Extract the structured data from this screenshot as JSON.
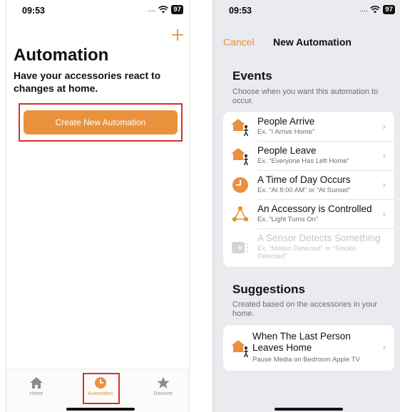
{
  "colors": {
    "accent": "#e8923d",
    "highlight": "#d93025",
    "disabled": "#c6c6c8"
  },
  "left": {
    "status": {
      "time": "09:53",
      "signal": "....",
      "battery": "97"
    },
    "add_icon": "plus-icon",
    "title": "Automation",
    "subtitle": "Have your accessories react to changes at home.",
    "create_button": "Create New Automation",
    "tabs": [
      {
        "label": "Home",
        "icon": "house-icon"
      },
      {
        "label": "Automation",
        "icon": "clock-icon",
        "active": true
      },
      {
        "label": "Discover",
        "icon": "star-icon"
      }
    ]
  },
  "right": {
    "status": {
      "time": "09:53",
      "signal": "....",
      "battery": "97"
    },
    "nav": {
      "cancel": "Cancel",
      "title": "New Automation"
    },
    "events": {
      "title": "Events",
      "description": "Choose when you want this automation to occur.",
      "items": [
        {
          "title": "People Arrive",
          "example": "Ex. “I Arrive Home”",
          "icon": "person-arrive-icon"
        },
        {
          "title": "People Leave",
          "example": "Ex. “Everyone Has Left Home”",
          "icon": "person-leave-icon"
        },
        {
          "title": "A Time of Day Occurs",
          "example": "Ex. “At 8:00 AM” or “At Sunset”",
          "icon": "clock-icon"
        },
        {
          "title": "An Accessory is Controlled",
          "example": "Ex. “Light Turns On”",
          "icon": "accessory-icon"
        },
        {
          "title": "A Sensor Detects Something",
          "example": "Ex. “Motion Detected” or “Smoke Detected”",
          "icon": "sensor-icon",
          "disabled": true
        }
      ]
    },
    "suggestions": {
      "title": "Suggestions",
      "description": "Created based on the accessories in your home.",
      "items": [
        {
          "title": "When The Last Person Leaves Home",
          "subtitle": "Pause Media on Bedroom Apple  TV",
          "icon": "person-leave-icon"
        }
      ]
    }
  }
}
